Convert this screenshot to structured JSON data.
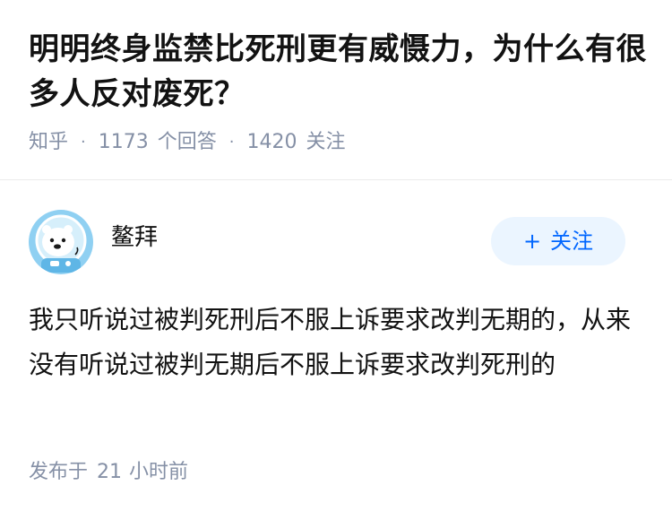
{
  "question": {
    "title": "明明终身监禁比死刑更有威慑力，为什么有很多人反对废死？",
    "platform": "知乎",
    "answer_count": "1173",
    "answer_label": "个回答",
    "follower_count": "1420",
    "follower_label": "关注",
    "separator": "·"
  },
  "answer": {
    "author_name": "鳌拜",
    "avatar_icon": "polar-bear-astronaut-avatar",
    "follow_label": "关注",
    "follow_plus": "+",
    "content": "我只听说过被判死刑后不服上诉要求改判无期的，从来没有听说过被判无期后不服上诉要求改判死刑的",
    "time_label": "发布于",
    "time_value": "21",
    "time_unit": "小时前"
  },
  "colors": {
    "title": "#121212",
    "meta": "#8590a6",
    "follow_bg": "#ebf5ff",
    "follow_text": "#0066ff",
    "divider": "#ebebeb"
  }
}
